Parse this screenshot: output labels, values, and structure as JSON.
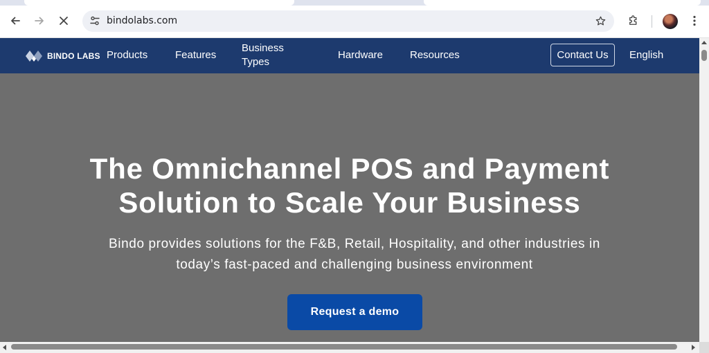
{
  "browser": {
    "url": "bindolabs.com",
    "icons": {
      "back": "arrow-left-icon",
      "forward": "arrow-right-icon",
      "stop": "close-icon",
      "site_info": "tune-icon",
      "bookmark": "star-icon",
      "extensions": "puzzle-icon",
      "menu": "more-vertical-icon"
    }
  },
  "header": {
    "logo_text": "BINDO LABS",
    "nav": {
      "products": "Products",
      "features": "Features",
      "business_types_line1": "Business",
      "business_types_line2": "Types",
      "hardware": "Hardware",
      "resources": "Resources"
    },
    "contact_label": "Contact Us",
    "language_label": "English"
  },
  "hero": {
    "title_line1": "The Omnichannel POS and Payment",
    "title_line2": "Solution to Scale Your Business",
    "subtitle_line1": "Bindo provides solutions for the F&B, Retail, Hospitality, and other industries in",
    "subtitle_line2": "today’s fast-paced and challenging business environment",
    "cta_label": "Request a demo"
  },
  "colors": {
    "header_bg": "#1d3a6e",
    "hero_bg": "#6e6e6e",
    "cta_bg": "#0a4aa6",
    "text_light": "#ffffff"
  }
}
